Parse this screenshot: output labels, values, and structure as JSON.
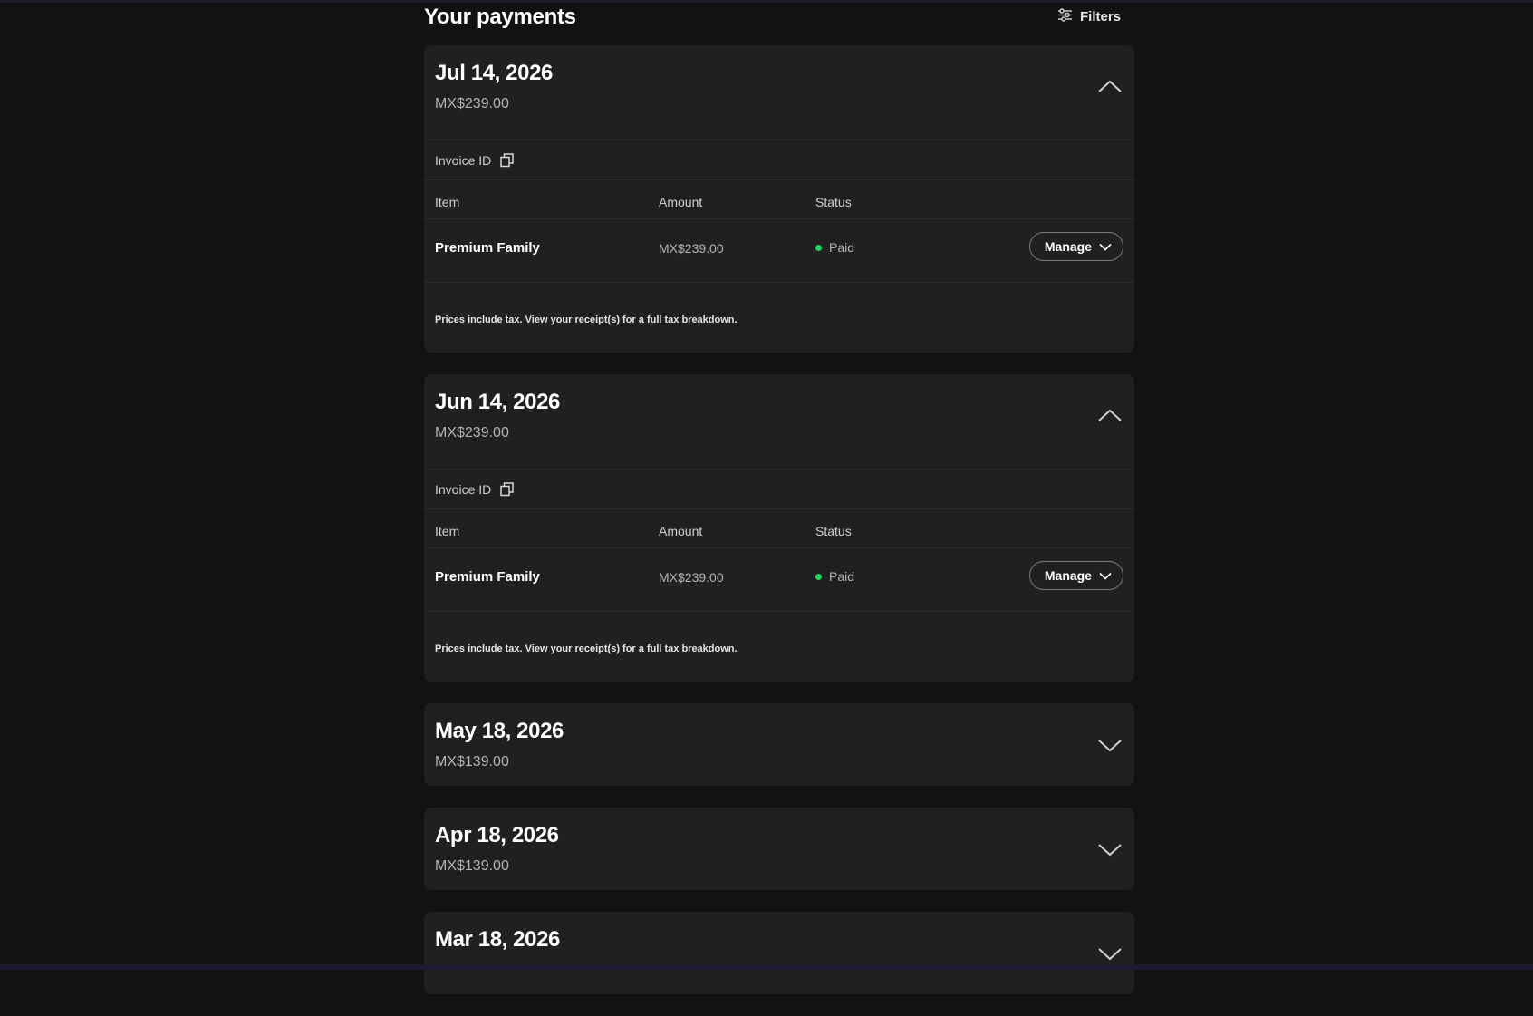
{
  "header": {
    "title": "Your payments",
    "filters_label": "Filters"
  },
  "labels": {
    "invoice_id": "Invoice ID",
    "col_item": "Item",
    "col_amount": "Amount",
    "col_status": "Status",
    "manage": "Manage",
    "tax_note": "Prices include tax. View your receipt(s) for a full tax breakdown."
  },
  "colors": {
    "background": "#121212",
    "card": "#202020",
    "paid": "#1ed760"
  },
  "payments": [
    {
      "date": "Jul 14, 2026",
      "total": "MX$239.00",
      "expanded": true,
      "items": [
        {
          "name": "Premium Family",
          "amount": "MX$239.00",
          "status": "Paid"
        }
      ]
    },
    {
      "date": "Jun 14, 2026",
      "total": "MX$239.00",
      "expanded": true,
      "items": [
        {
          "name": "Premium Family",
          "amount": "MX$239.00",
          "status": "Paid"
        }
      ]
    },
    {
      "date": "May 18, 2026",
      "total": "MX$139.00",
      "expanded": false
    },
    {
      "date": "Apr 18, 2026",
      "total": "MX$139.00",
      "expanded": false
    },
    {
      "date": "Mar 18, 2026",
      "total": "",
      "expanded": false
    }
  ]
}
